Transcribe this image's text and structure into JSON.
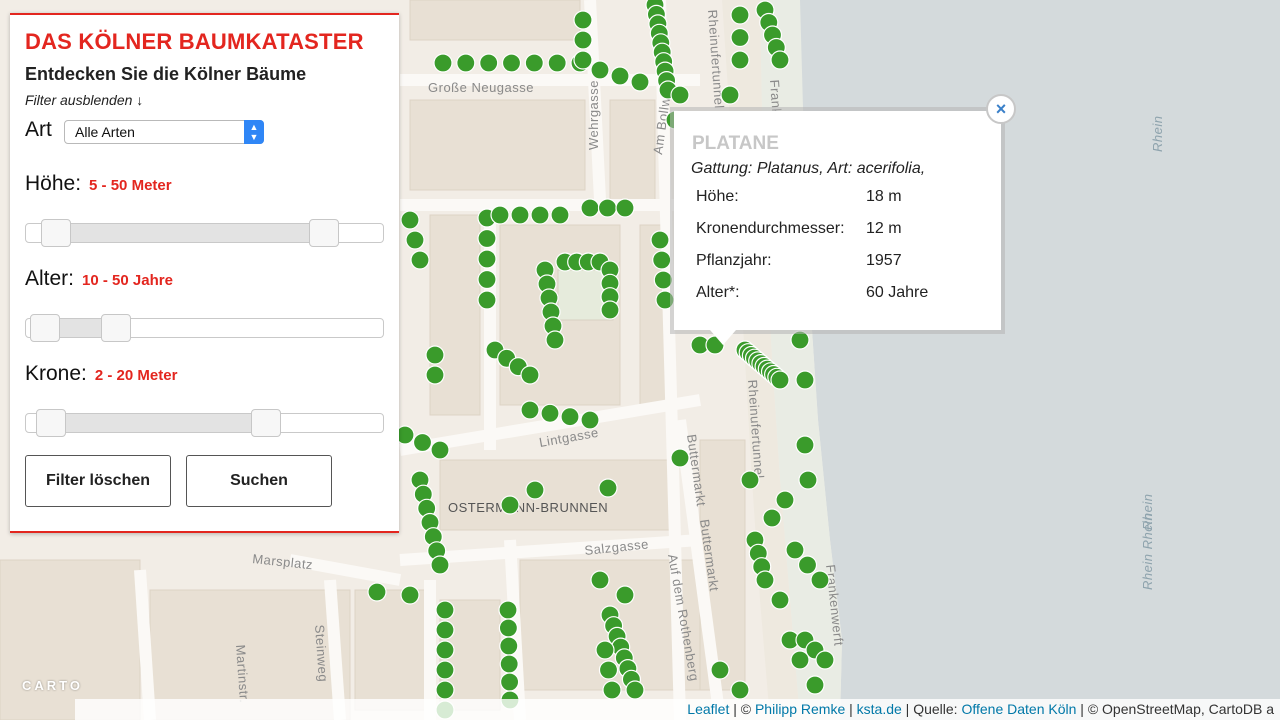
{
  "panel": {
    "title": "DAS KÖLNER BAUMKATASTER",
    "subtitle": "Entdecken Sie die Kölner Bäume",
    "filter_toggle": "Filter ausblenden ↓",
    "art_label": "Art",
    "art_selected": "Alle Arten",
    "hoehe_label": "Höhe:",
    "hoehe_range": "5 - 50 Meter",
    "alter_label": "Alter:",
    "alter_range": "10 - 50 Jahre",
    "krone_label": "Krone:",
    "krone_range": "2 - 20 Meter",
    "clear_button": "Filter löschen",
    "search_button": "Suchen"
  },
  "popup": {
    "title": "PLATANE",
    "genus": "Gattung: Platanus, Art: acerifolia,",
    "close": "×",
    "rows": [
      {
        "key": "Höhe:",
        "value": "18 m"
      },
      {
        "key": "Kronendurchmesser:",
        "value": "12 m"
      },
      {
        "key": "Pflanzjahr:",
        "value": "1957"
      },
      {
        "key": "Alter*:",
        "value": "60 Jahre"
      }
    ]
  },
  "map": {
    "street_labels": {
      "grosse_neugasse": "Große Neugasse",
      "wehrgasse": "Wehrgasse",
      "bollwerk": "Am Bollwerk",
      "rheinufertunnel_n": "Rheinufertunnel",
      "lintgasse": "Lintgasse",
      "buttermarkt1": "Buttermarkt",
      "buttermarkt2": "Buttermarkt",
      "rheinufertunnel_s": "Rheinufertunnel",
      "ostermann": "OSTERMANN-BRUNNEN",
      "salzgasse": "Salzgasse",
      "marsplatz": "Marsplatz",
      "steinweg": "Steinweg",
      "martinstr": "Martinstr.",
      "rothenberg": "Auf dem Rothenberg",
      "frankenwerft_n": "Frankenwerft",
      "frankenwerft_s": "Frankenwerft",
      "rhein1": "Rhein",
      "rhein2": "Rhein",
      "rhein3": "Rhein Rhein"
    },
    "carto_logo": "CARTO",
    "colors": {
      "water": "#d4dadc",
      "land": "#f2ede6",
      "tree": "#3a9b2b",
      "accent": "#e3261f"
    }
  },
  "attribution": {
    "leaflet": "Leaflet",
    "sep1": " | © ",
    "author": "Philipp Remke",
    "sep2": " | ",
    "ksta": "ksta.de",
    "sep3": " | Quelle: ",
    "source": "Offene Daten Köln",
    "rest": " | © OpenStreetMap, CartoDB a"
  }
}
